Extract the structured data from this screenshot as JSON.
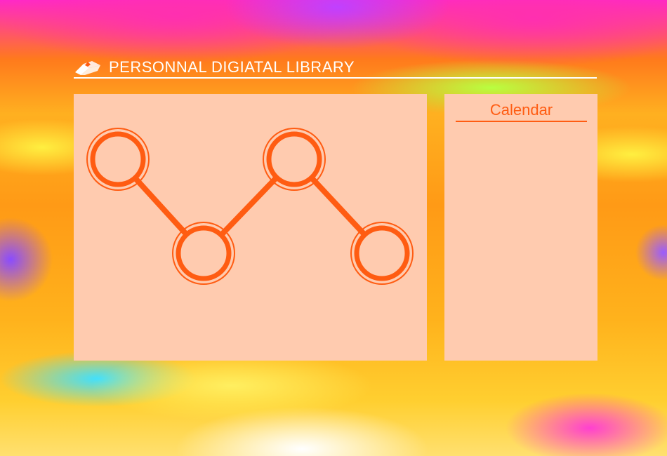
{
  "header": {
    "title": "PERSONNAL DIGIATAL LIBRARY",
    "logo_icon": "open-book-icon"
  },
  "main": {
    "graphic_icon": "connected-circles-zigzag-icon",
    "accent_color": "#ff5c12",
    "panel_color": "#ffcbaf"
  },
  "calendar": {
    "title": "Calendar"
  }
}
